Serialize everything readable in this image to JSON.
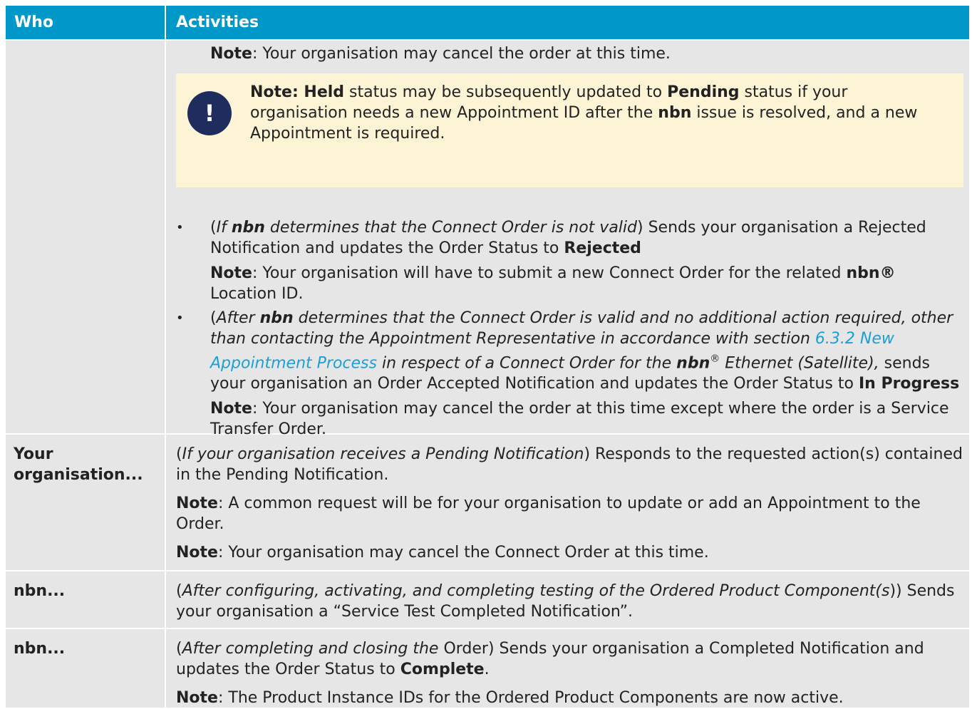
{
  "header": {
    "who": "Who",
    "activities": "Activities"
  },
  "row1": {
    "note1_label": "Note",
    "note1_text": ": Your organisation may cancel the order at this time.",
    "callout": {
      "icon": "!",
      "a": "Note: Held",
      "b": " status may be subsequently updated to ",
      "c": "Pending",
      "d": " status if your organisation needs a new Appointment ID after the ",
      "e": "nbn",
      "f": " issue is resolved, and a new Appointment is required."
    },
    "b1": {
      "p1": "(",
      "p2": "If ",
      "p3": "nbn",
      "p4": " determines that the Connect Order is not valid",
      "p5": ") Sends your organisation a Rejected Notification and updates the Order Status to ",
      "p6": "Rejected",
      "n1": "Note",
      "n2": ": Your organisation will have to submit a new Connect Order for the related ",
      "n3": "nbn®",
      "n4": " Location ID."
    },
    "b2": {
      "p1": "(",
      "p2": "After ",
      "p3": "nbn",
      "p4": " determines that the Connect Order is valid and no additional action required, other than contacting the Appointment Representative in accordance with section ",
      "p5": "6.3.2 New Appointment Process",
      "p6": " in respect of a Connect Order for the ",
      "p7": "nbn",
      "p8": "®",
      "p9": " Ethernet (Satellite),",
      "p10": " sends your organisation an Order Accepted Notification and updates the Order Status to ",
      "p11": "In Progress",
      "n1": "Note",
      "n2": ": Your organisation may cancel the order at this time except where the order is a Service Transfer Order."
    }
  },
  "row2": {
    "who": "Your organisation...",
    "p1a": "(",
    "p1b": "If your organisation receives a Pending Notification",
    "p1c": ") Responds to the requested action(s) contained in the Pending Notification.",
    "n1a": "Note",
    "n1b": ": A common request will be for your organisation to update or add an Appointment to the Order.",
    "n2a": "Note",
    "n2b": ": Your organisation may cancel the Connect Order at this time."
  },
  "row3": {
    "who": "nbn...",
    "a": "(",
    "b": "After configuring, activating, and completing testing of the Ordered Product Component(s",
    "c": ")) Sends your organisation a “Service Test Completed Notification”."
  },
  "row4": {
    "who": "nbn...",
    "a": "(",
    "b": "After completing and closing the",
    "c": " Order) Sends your organisation a Completed Notification and updates the Order Status to ",
    "d": "Complete",
    "e": ".",
    "n1": "Note",
    "n2": ": The Product Instance IDs for the Ordered Product Components are now active."
  }
}
